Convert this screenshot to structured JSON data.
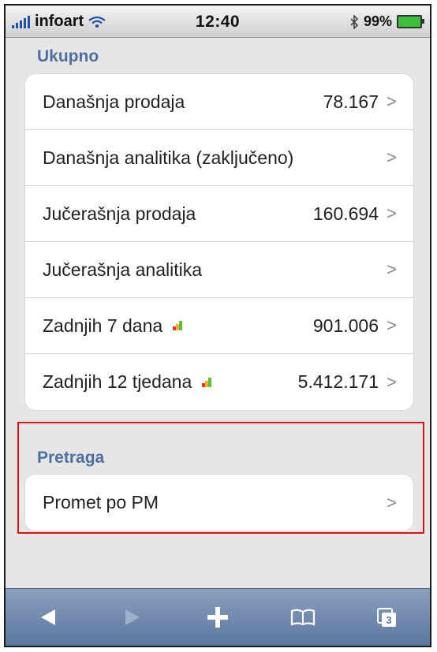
{
  "status_bar": {
    "carrier": "infoart",
    "time": "12:40",
    "battery": "99%"
  },
  "sections": [
    {
      "title": "Ukupno",
      "rows": [
        {
          "label": "Današnja prodaja",
          "value": "78.167",
          "trend": false
        },
        {
          "label": "Današnja analitika (zaključeno)",
          "value": "",
          "trend": false
        },
        {
          "label": "Jučerašnja prodaja",
          "value": "160.694",
          "trend": false
        },
        {
          "label": "Jučerašnja analitika",
          "value": "",
          "trend": false
        },
        {
          "label": "Zadnjih 7 dana",
          "value": "901.006",
          "trend": true
        },
        {
          "label": "Zadnjih 12 tjedana",
          "value": "5.412.171",
          "trend": true
        }
      ]
    },
    {
      "title": "Pretraga",
      "rows": [
        {
          "label": "Promet po PM",
          "value": "",
          "trend": false
        }
      ]
    }
  ],
  "chevron": ">",
  "toolbar": {
    "tabs_count": "3",
    "icons": [
      "back-arrow-icon",
      "forward-arrow-icon",
      "plus-icon",
      "bookmarks-icon",
      "tabs-icon"
    ]
  },
  "colors": {
    "section_title": "#4e6ea0",
    "highlight": "#e01010",
    "toolbar": "#6d86ad"
  }
}
